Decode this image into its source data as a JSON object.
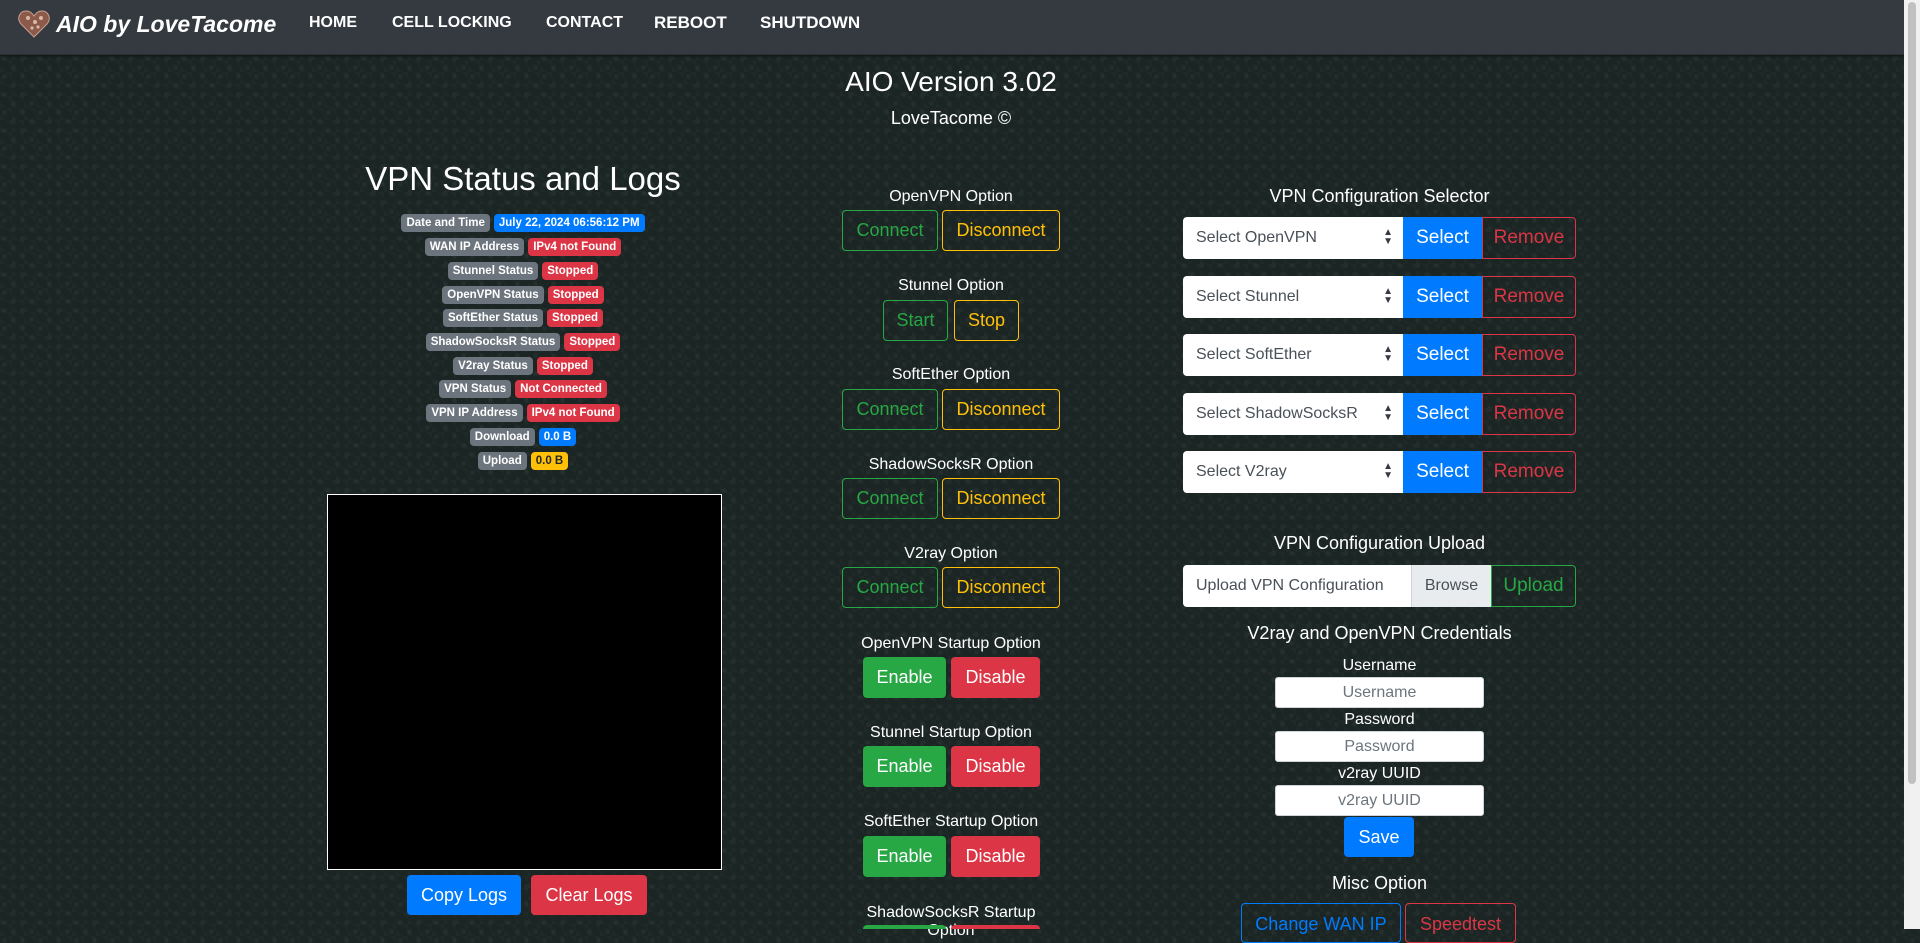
{
  "nav": {
    "brand": "AIO by LoveTacome",
    "links": [
      "HOME",
      "CELL LOCKING",
      "CONTACT",
      "REBOOT",
      "SHUTDOWN"
    ]
  },
  "header": {
    "version": "AIO Version 3.02",
    "copyright": "LoveTacome ©"
  },
  "status": {
    "title": "VPN Status and Logs",
    "rows": [
      {
        "label": "Date and Time",
        "value": "July 22, 2024 06:56:12 PM",
        "color": "#007bff"
      },
      {
        "label": "WAN IP Address",
        "value": "IPv4 not Found",
        "color": "#dc3545"
      },
      {
        "label": "Stunnel Status",
        "value": "Stopped",
        "color": "#dc3545"
      },
      {
        "label": "OpenVPN Status",
        "value": "Stopped",
        "color": "#dc3545"
      },
      {
        "label": "SoftEther Status",
        "value": "Stopped",
        "color": "#dc3545"
      },
      {
        "label": "ShadowSocksR Status",
        "value": "Stopped",
        "color": "#dc3545"
      },
      {
        "label": "V2ray Status",
        "value": "Stopped",
        "color": "#dc3545"
      },
      {
        "label": "VPN Status",
        "value": "Not Connected",
        "color": "#dc3545"
      },
      {
        "label": "VPN IP Address",
        "value": "IPv4 not Found",
        "color": "#dc3545"
      },
      {
        "label": "Download",
        "value": "0.0 B",
        "color": "#007bff"
      },
      {
        "label": "Upload",
        "value": "0.0 B",
        "color": "#ffc107"
      }
    ],
    "copy_logs": "Copy Logs",
    "clear_logs": "Clear Logs"
  },
  "options": {
    "openvpn": {
      "label": "OpenVPN Option",
      "connect": "Connect",
      "disconnect": "Disconnect"
    },
    "stunnel": {
      "label": "Stunnel Option",
      "start": "Start",
      "stop": "Stop"
    },
    "softether": {
      "label": "SoftEther Option",
      "connect": "Connect",
      "disconnect": "Disconnect"
    },
    "shadowsocksr": {
      "label": "ShadowSocksR Option",
      "connect": "Connect",
      "disconnect": "Disconnect"
    },
    "v2ray": {
      "label": "V2ray Option",
      "connect": "Connect",
      "disconnect": "Disconnect"
    },
    "openvpn_startup": {
      "label": "OpenVPN Startup Option",
      "enable": "Enable",
      "disable": "Disable"
    },
    "stunnel_startup": {
      "label": "Stunnel Startup Option",
      "enable": "Enable",
      "disable": "Disable"
    },
    "softether_startup": {
      "label": "SoftEther Startup Option",
      "enable": "Enable",
      "disable": "Disable"
    },
    "shadowsocksr_startup": {
      "label": "ShadowSocksR Startup Option"
    }
  },
  "config": {
    "selector_title": "VPN Configuration Selector",
    "selectors": [
      {
        "placeholder": "Select OpenVPN",
        "select": "Select",
        "remove": "Remove"
      },
      {
        "placeholder": "Select Stunnel",
        "select": "Select",
        "remove": "Remove"
      },
      {
        "placeholder": "Select SoftEther",
        "select": "Select",
        "remove": "Remove"
      },
      {
        "placeholder": "Select ShadowSocksR",
        "select": "Select",
        "remove": "Remove"
      },
      {
        "placeholder": "Select V2ray",
        "select": "Select",
        "remove": "Remove"
      }
    ],
    "upload_title": "VPN Configuration Upload",
    "upload_placeholder": "Upload VPN Configuration",
    "browse": "Browse",
    "upload": "Upload",
    "credentials_title": "V2ray and OpenVPN Credentials",
    "username_label": "Username",
    "username_placeholder": "Username",
    "password_label": "Password",
    "password_placeholder": "Password",
    "uuid_label": "v2ray UUID",
    "uuid_placeholder": "v2ray UUID",
    "save": "Save",
    "misc_title": "Misc Option",
    "change_wan_ip": "Change WAN IP",
    "speedtest": "Speedtest"
  }
}
